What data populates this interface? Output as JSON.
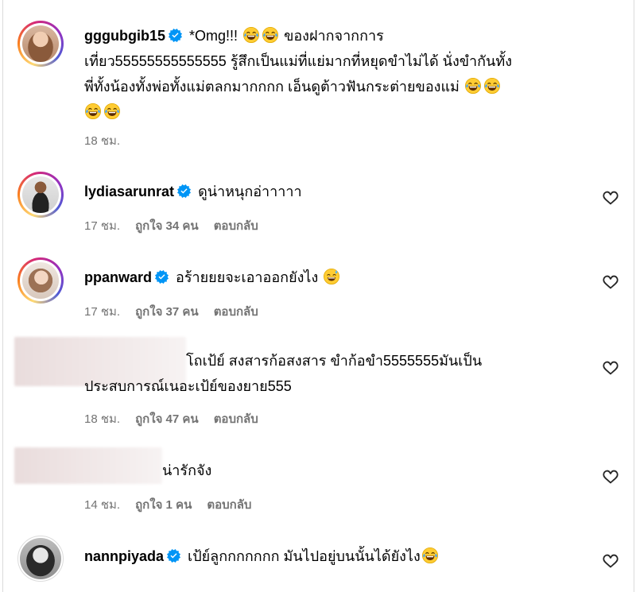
{
  "comments": [
    {
      "username": "gggubgib15",
      "verified": true,
      "avatar_icon": "profile-photo-woman-icon",
      "has_story_ring": true,
      "text_line1": "*Omg!!!",
      "text_line1_rest": "ของฝากจากการ",
      "text_line2": "เที่ยว55555555555555 รู้สึกเป็นแม่ที่แย่มากที่หยุดขำไม่ได้ นั่งขำกันทั้ง",
      "text_line3": "พี่ทั้งน้องทั้งพ่อทั้งแม่ตลกมากกกก เอ็นดูต้าวฟันกระต่ายของแม่",
      "time": "18 ชม."
    },
    {
      "username": "lydiasarunrat",
      "verified": true,
      "avatar_icon": "profile-photo-woman-icon",
      "has_story_ring": true,
      "text": "ดูน่าหนุกอ่าาาาา",
      "time": "17 ชม.",
      "likes": "ถูกใจ 34 คน",
      "reply": "ตอบกลับ"
    },
    {
      "username": "ppanward",
      "verified": true,
      "avatar_icon": "profile-photo-woman-icon",
      "has_story_ring": true,
      "text": "อร้ายยยจะเอาออกยังไง",
      "time": "17 ชม.",
      "likes": "ถูกใจ 37 คน",
      "reply": "ตอบกลับ"
    },
    {
      "username": "",
      "verified": false,
      "avatar_icon": "blurred-avatar-icon",
      "text_line1": "โถเป้ย์ สงสารก้อสงสาร ขำก้อขำ5555555มันเป็น",
      "text_line2": "ประสบการณ์เนอะเป้ย์ของยาย555",
      "time": "18 ชม.",
      "likes": "ถูกใจ 47 คน",
      "reply": "ตอบกลับ"
    },
    {
      "username": "",
      "verified": false,
      "avatar_icon": "blurred-avatar-icon",
      "text": "น่ารักจัง",
      "time": "14 ชม.",
      "likes": "ถูกใจ 1 คน",
      "reply": "ตอบกลับ"
    },
    {
      "username": "nannpiyada",
      "verified": true,
      "avatar_icon": "profile-photo-woman-icon",
      "has_story_ring": false,
      "text": "เป้ย์ลูกกกกกกก มันไปอยู่บนนั้นได้ยังไง"
    }
  ],
  "icons": {
    "verified": "verified-badge-icon",
    "heart": "heart-outline-icon",
    "laugh_emoji": "face-with-tears-of-joy-icon",
    "sweat_emoji": "grinning-face-with-sweat-icon"
  },
  "colors": {
    "verified": "#0095f6",
    "meta": "#737373",
    "border": "#dbdbdb"
  }
}
